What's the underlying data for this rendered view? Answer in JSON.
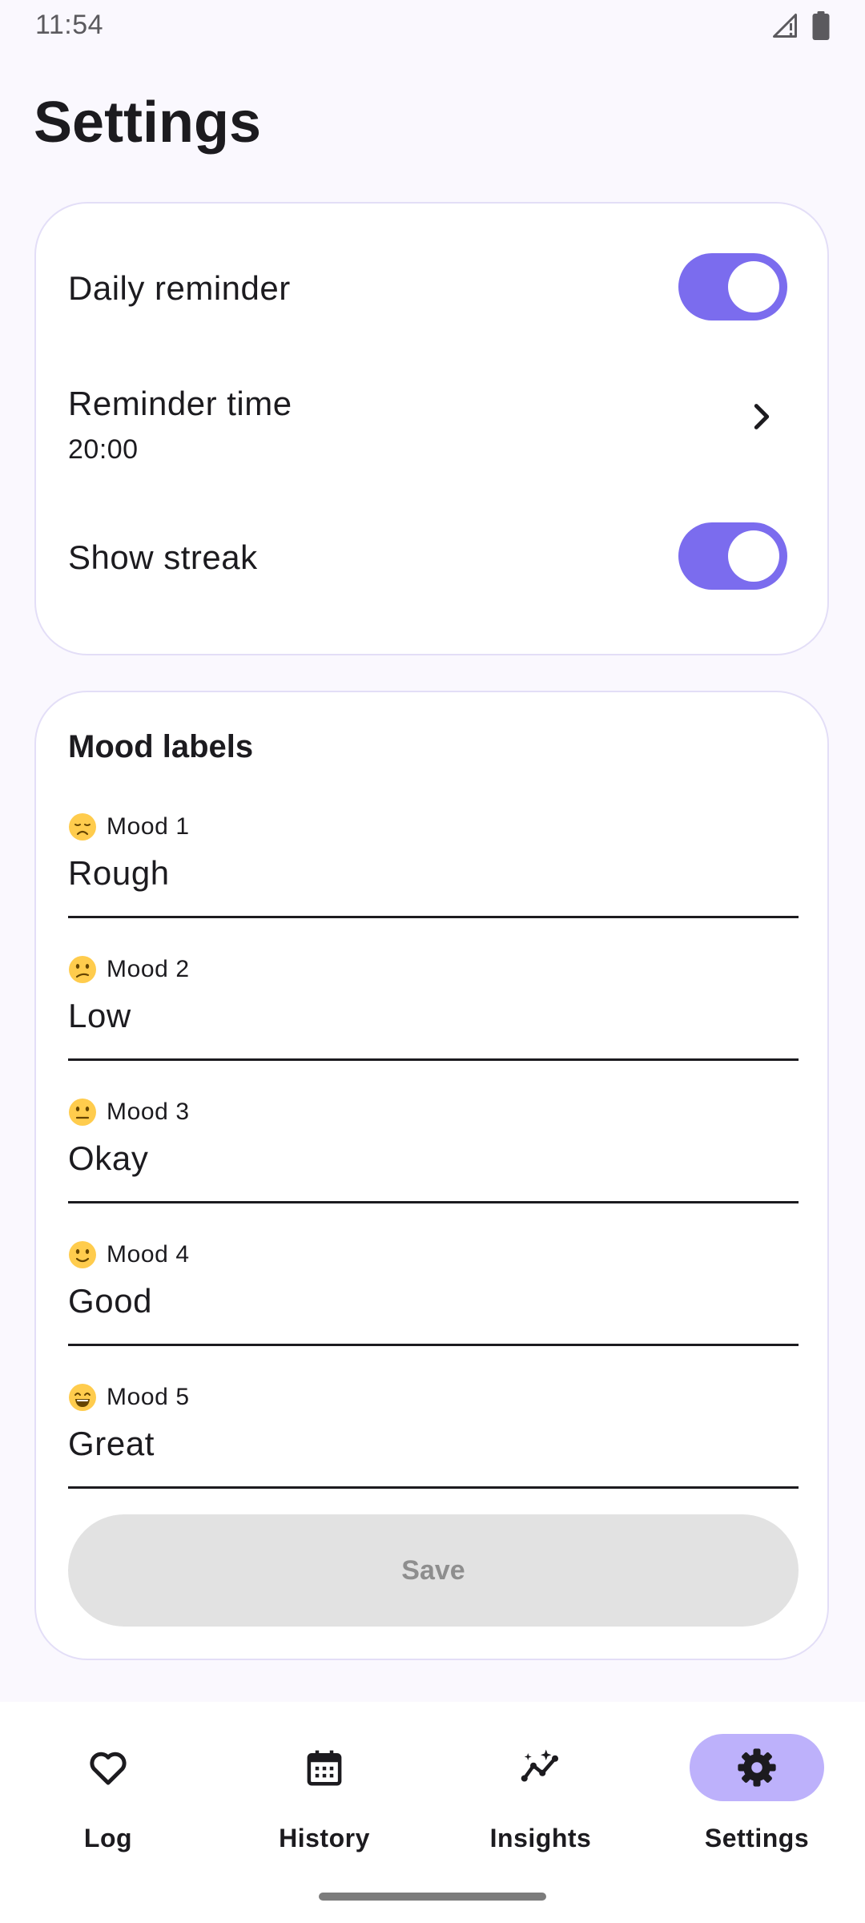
{
  "status_bar": {
    "time": "11:54",
    "icons": [
      "signal-icon",
      "battery-icon"
    ]
  },
  "page": {
    "title": "Settings"
  },
  "settings": {
    "daily_reminder": {
      "label": "Daily reminder",
      "enabled": true
    },
    "reminder_time": {
      "label": "Reminder time",
      "value": "20:00",
      "icon": "chevron-right-icon"
    },
    "show_streak": {
      "label": "Show streak",
      "enabled": true
    }
  },
  "mood_labels": {
    "title": "Mood labels",
    "items": [
      {
        "caption": "Mood 1",
        "emoji": "disappointed-face",
        "value": "Rough"
      },
      {
        "caption": "Mood 2",
        "emoji": "confused-face",
        "value": "Low"
      },
      {
        "caption": "Mood 3",
        "emoji": "neutral-face",
        "value": "Okay"
      },
      {
        "caption": "Mood 4",
        "emoji": "slightly-smiling-face",
        "value": "Good"
      },
      {
        "caption": "Mood 5",
        "emoji": "grinning-face",
        "value": "Great"
      }
    ],
    "save_label": "Save"
  },
  "bottom_nav": {
    "items": [
      {
        "label": "Log",
        "icon": "heart-icon",
        "active": false
      },
      {
        "label": "History",
        "icon": "calendar-icon",
        "active": false
      },
      {
        "label": "Insights",
        "icon": "insights-icon",
        "active": false
      },
      {
        "label": "Settings",
        "icon": "gear-icon",
        "active": true
      }
    ]
  },
  "colors": {
    "background": "#FAF8FE",
    "accent": "#7B6CEE",
    "active_nav_pill": "#BDB1FB",
    "card_border": "#E3DEF7",
    "disabled_button": "#E2E2E2"
  }
}
